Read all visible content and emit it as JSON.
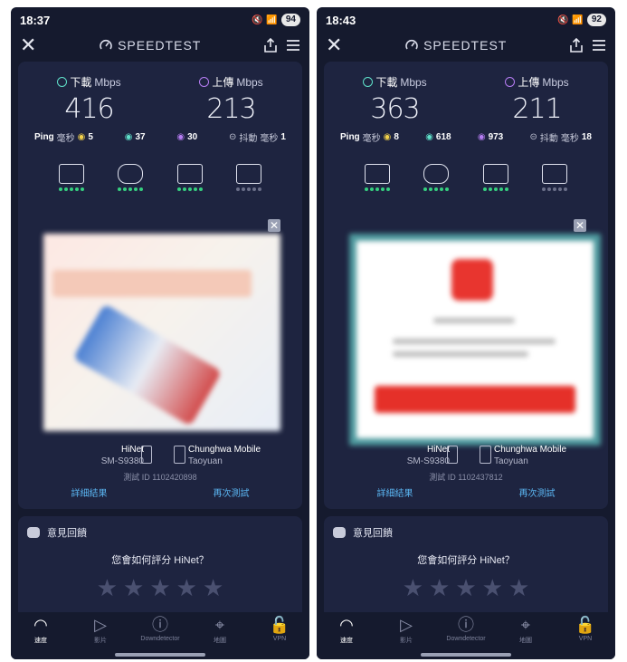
{
  "screens": [
    {
      "time": "18:37",
      "battery": "94",
      "brand": "SPEEDTEST",
      "download": {
        "label": "下載",
        "unit": "Mbps",
        "value": "416"
      },
      "upload": {
        "label": "上傳",
        "unit": "Mbps",
        "value": "213"
      },
      "ping": {
        "label": "Ping",
        "unit": "毫秒",
        "idle": "5",
        "down": "37",
        "up": "30"
      },
      "jitter": {
        "label": "抖動",
        "unit": "毫秒",
        "value": "1"
      },
      "isp": {
        "name": "HiNet",
        "device": "SM-S9380"
      },
      "server": {
        "name": "Chunghwa Mobile",
        "location": "Taoyuan"
      },
      "result_id": "測試 ID 1102420898",
      "details_link": "詳細結果",
      "retest_link": "再次測試",
      "feedback_title": "意見回饋",
      "feedback_question": "您會如何評分 HiNet？",
      "nav": [
        "速度",
        "影片",
        "Downdetector",
        "地圖",
        "VPN"
      ]
    },
    {
      "time": "18:43",
      "battery": "92",
      "brand": "SPEEDTEST",
      "download": {
        "label": "下載",
        "unit": "Mbps",
        "value": "363"
      },
      "upload": {
        "label": "上傳",
        "unit": "Mbps",
        "value": "211"
      },
      "ping": {
        "label": "Ping",
        "unit": "毫秒",
        "idle": "8",
        "down": "618",
        "up": "973"
      },
      "jitter": {
        "label": "抖動",
        "unit": "毫秒",
        "value": "18"
      },
      "isp": {
        "name": "HiNet",
        "device": "SM-S9380"
      },
      "server": {
        "name": "Chunghwa Mobile",
        "location": "Taoyuan"
      },
      "result_id": "測試 ID 1102437812",
      "details_link": "詳細結果",
      "retest_link": "再次測試",
      "feedback_title": "意見回饋",
      "feedback_question": "您會如何評分 HiNet？",
      "nav": [
        "速度",
        "影片",
        "Downdetector",
        "地圖",
        "VPN"
      ]
    }
  ],
  "colors": {
    "background": "#151a2e",
    "card": "#1e2440",
    "download": "#5fe0c9",
    "upload": "#b57cf2",
    "link": "#5ab4f0",
    "good_dot": "#35d07f"
  },
  "icons": [
    "close-icon",
    "speedtest-logo-icon",
    "share-icon",
    "menu-icon",
    "browsing-icon",
    "gaming-icon",
    "video-icon",
    "video-call-icon"
  ]
}
